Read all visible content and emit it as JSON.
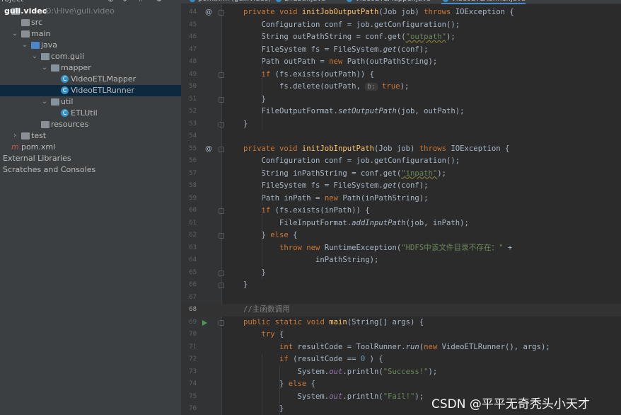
{
  "project_panel": {
    "header": "roject",
    "tree": [
      {
        "label": "guli.video",
        "path": "D:\\Hive\\guli.video",
        "indent": 0,
        "arrow": "",
        "icon": "folder",
        "bold": true
      },
      {
        "label": "src",
        "indent": 1,
        "arrow": "",
        "icon": "folder"
      },
      {
        "label": "main",
        "indent": 1,
        "arrow": "v",
        "icon": "folder"
      },
      {
        "label": "java",
        "indent": 2,
        "arrow": "v",
        "icon": "folder-blue"
      },
      {
        "label": "com.guli",
        "indent": 3,
        "arrow": "v",
        "icon": "folder-pkg"
      },
      {
        "label": "mapper",
        "indent": 4,
        "arrow": "v",
        "icon": "folder-pkg"
      },
      {
        "label": "VideoETLMapper",
        "indent": 5,
        "arrow": "",
        "icon": "class"
      },
      {
        "label": "VideoETLRunner",
        "indent": 5,
        "arrow": "",
        "icon": "class",
        "selected": true
      },
      {
        "label": "util",
        "indent": 4,
        "arrow": "v",
        "icon": "folder-pkg"
      },
      {
        "label": "ETLUtil",
        "indent": 5,
        "arrow": "",
        "icon": "class"
      },
      {
        "label": "resources",
        "indent": 3,
        "arrow": "",
        "icon": "folder-res"
      },
      {
        "label": "test",
        "indent": 1,
        "arrow": ">",
        "icon": "folder"
      },
      {
        "label": "pom.xml",
        "indent": 0,
        "arrow": "",
        "icon": "maven"
      },
      {
        "label": "External Libraries",
        "indent": 0,
        "arrow": "",
        "icon": "none"
      },
      {
        "label": "Scratches and Consoles",
        "indent": 0,
        "arrow": "",
        "icon": "none"
      }
    ]
  },
  "tabs": [
    {
      "label": "pom.xml (guli.video)",
      "active": false
    },
    {
      "label": "ETLUtil.java",
      "active": false
    },
    {
      "label": "VideoETLMapper.java",
      "active": false
    },
    {
      "label": "VideoETLRunner.java",
      "active": true
    }
  ],
  "editor": {
    "current_line": 68,
    "lines": [
      {
        "n": "44",
        "gutter": "@"
      },
      {
        "n": "45"
      },
      {
        "n": "46"
      },
      {
        "n": "47"
      },
      {
        "n": "48"
      },
      {
        "n": "49"
      },
      {
        "n": "50"
      },
      {
        "n": "51"
      },
      {
        "n": "52"
      },
      {
        "n": "53"
      },
      {
        "n": "54"
      },
      {
        "n": "55",
        "gutter": "@"
      },
      {
        "n": "56"
      },
      {
        "n": "57"
      },
      {
        "n": "58"
      },
      {
        "n": "59"
      },
      {
        "n": "60"
      },
      {
        "n": "61"
      },
      {
        "n": "62"
      },
      {
        "n": "63"
      },
      {
        "n": "64"
      },
      {
        "n": "65"
      },
      {
        "n": "66"
      },
      {
        "n": "67"
      },
      {
        "n": "68"
      },
      {
        "n": "69",
        "gutter": "run"
      },
      {
        "n": "70"
      },
      {
        "n": "71"
      },
      {
        "n": "72"
      },
      {
        "n": "73"
      },
      {
        "n": "74"
      },
      {
        "n": "75"
      },
      {
        "n": "76"
      }
    ],
    "code": [
      [
        [
          "kw",
          "private "
        ],
        [
          "kw",
          "void "
        ],
        [
          "fn",
          "initJobOutputPath"
        ],
        [
          "",
          "(Job job) "
        ],
        [
          "kw",
          "throws "
        ],
        [
          "",
          "IOException {"
        ]
      ],
      [
        [
          "",
          "    Configuration conf = job.getConfiguration();"
        ]
      ],
      [
        [
          "",
          "    String outPathString = conf.get("
        ],
        [
          "str",
          "\"outpath\""
        ],
        [
          "",
          ");"
        ]
      ],
      [
        [
          "",
          "    FileSystem fs = FileSystem."
        ],
        [
          "it",
          "get"
        ],
        [
          "",
          "(conf);"
        ]
      ],
      [
        [
          "",
          "    Path outPath = "
        ],
        [
          "kw",
          "new "
        ],
        [
          "",
          "Path(outPathString);"
        ]
      ],
      [
        [
          "",
          "    "
        ],
        [
          "kw",
          "if "
        ],
        [
          "",
          "(fs.exists(outPath)) {"
        ]
      ],
      [
        [
          "",
          "        fs.delete(outPath, "
        ],
        [
          "hint",
          "b:"
        ],
        [
          "kw",
          " true"
        ],
        [
          "",
          ");"
        ]
      ],
      [
        [
          "",
          "    }"
        ]
      ],
      [
        [
          "",
          "    FileOutputFormat."
        ],
        [
          "it",
          "setOutputPath"
        ],
        [
          "",
          "(job, outPath);"
        ]
      ],
      [
        [
          "",
          "}"
        ]
      ],
      [
        [
          "",
          ""
        ]
      ],
      [
        [
          "kw",
          "private "
        ],
        [
          "kw",
          "void "
        ],
        [
          "fn",
          "initJobInputPath"
        ],
        [
          "",
          "(Job job) "
        ],
        [
          "kw",
          "throws "
        ],
        [
          "",
          "IOException {"
        ]
      ],
      [
        [
          "",
          "    Configuration conf = job.getConfiguration();"
        ]
      ],
      [
        [
          "",
          "    String inPathString = conf.get("
        ],
        [
          "str",
          "\"inpath\""
        ],
        [
          "",
          ");"
        ]
      ],
      [
        [
          "",
          "    FileSystem fs = FileSystem."
        ],
        [
          "it",
          "get"
        ],
        [
          "",
          "(conf);"
        ]
      ],
      [
        [
          "",
          "    Path inPath = "
        ],
        [
          "kw",
          "new "
        ],
        [
          "",
          "Path(inPathString);"
        ]
      ],
      [
        [
          "",
          "    "
        ],
        [
          "kw",
          "if "
        ],
        [
          "",
          "(fs.exists(inPath)) {"
        ]
      ],
      [
        [
          "",
          "        FileInputFormat."
        ],
        [
          "it",
          "addInputPath"
        ],
        [
          "",
          "(job, inPath);"
        ]
      ],
      [
        [
          "",
          "    } "
        ],
        [
          "kw",
          "else "
        ],
        [
          "",
          "{"
        ]
      ],
      [
        [
          "",
          "        "
        ],
        [
          "kw",
          "throw new "
        ],
        [
          "",
          "RuntimeException("
        ],
        [
          "str",
          "\"HDFS中该文件目录不存在：\""
        ],
        [
          "",
          " +"
        ]
      ],
      [
        [
          "",
          "                inPathString);"
        ]
      ],
      [
        [
          "",
          "    }"
        ]
      ],
      [
        [
          "",
          "}"
        ]
      ],
      [
        [
          "",
          ""
        ]
      ],
      [
        [
          "cm",
          "//主函数调用"
        ]
      ],
      [
        [
          "kw",
          "public "
        ],
        [
          "kw",
          "static "
        ],
        [
          "kw",
          "void "
        ],
        [
          "fn",
          "main"
        ],
        [
          "",
          "(String[] args) {"
        ]
      ],
      [
        [
          "",
          "    "
        ],
        [
          "kw",
          "try "
        ],
        [
          "",
          "{"
        ]
      ],
      [
        [
          "",
          "        "
        ],
        [
          "kw",
          "int "
        ],
        [
          "",
          "resultCode = ToolRunner."
        ],
        [
          "it",
          "run"
        ],
        [
          "",
          "("
        ],
        [
          "kw",
          "new "
        ],
        [
          "",
          "VideoETLRunner(), args);"
        ]
      ],
      [
        [
          "",
          "        "
        ],
        [
          "kw",
          "if "
        ],
        [
          "",
          "(resultCode == "
        ],
        [
          "num",
          "0"
        ],
        [
          "",
          " ) {"
        ]
      ],
      [
        [
          "",
          "            System."
        ],
        [
          "st",
          "out"
        ],
        [
          "",
          ".println("
        ],
        [
          "str",
          "\"Success!\""
        ],
        [
          "",
          ");"
        ]
      ],
      [
        [
          "",
          "        } "
        ],
        [
          "kw",
          "else "
        ],
        [
          "",
          "{"
        ]
      ],
      [
        [
          "",
          "            System."
        ],
        [
          "st",
          "out"
        ],
        [
          "",
          ".println("
        ],
        [
          "str",
          "\"Fail!\""
        ],
        [
          "",
          ");"
        ]
      ],
      [
        [
          "",
          "        }"
        ]
      ]
    ]
  },
  "watermark": "CSDN @平平无奇秃头小天才"
}
